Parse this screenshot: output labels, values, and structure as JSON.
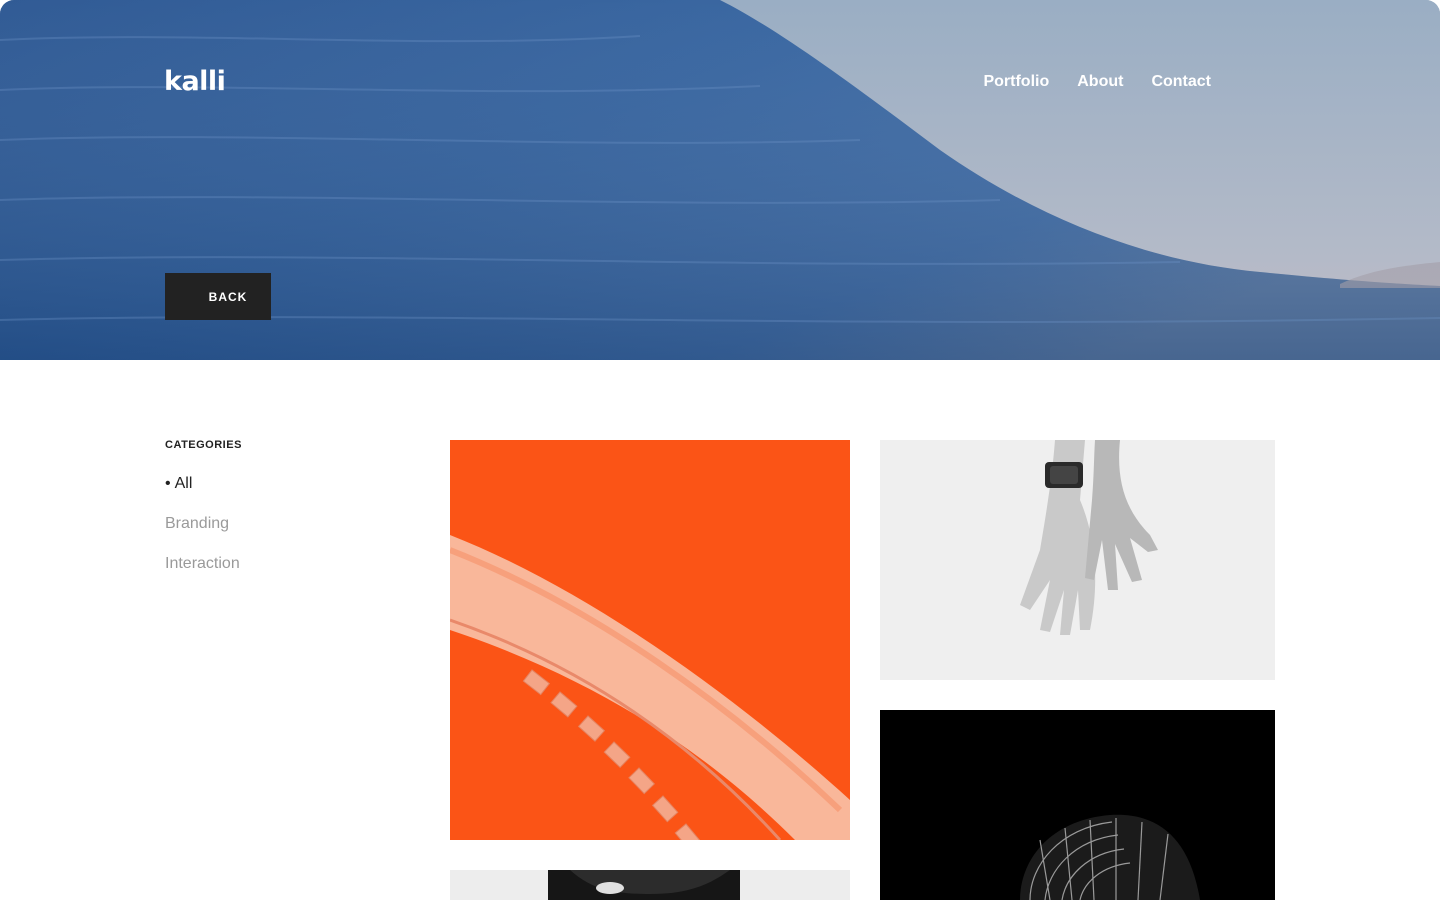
{
  "header": {
    "logo": "kalli",
    "nav": [
      {
        "label": "Portfolio"
      },
      {
        "label": "About"
      },
      {
        "label": "Contact"
      }
    ],
    "back_label": "BACK"
  },
  "sidebar": {
    "title": "CATEGORIES",
    "items": [
      {
        "label": "All",
        "active": true
      },
      {
        "label": "Branding",
        "active": false
      },
      {
        "label": "Interaction",
        "active": false
      }
    ]
  },
  "portfolio": {
    "items": [
      {
        "name": "orange-staircase",
        "bg": "#fb5416"
      },
      {
        "name": "hands-with-watch",
        "bg": "#efefef"
      },
      {
        "name": "abstract-sphere",
        "bg": "#000000"
      },
      {
        "name": "portrait",
        "bg": "#ededed"
      }
    ]
  },
  "colors": {
    "accent_dark": "#222222",
    "muted_text": "#9a9a9a",
    "hero_sea": "#2d5a98"
  }
}
